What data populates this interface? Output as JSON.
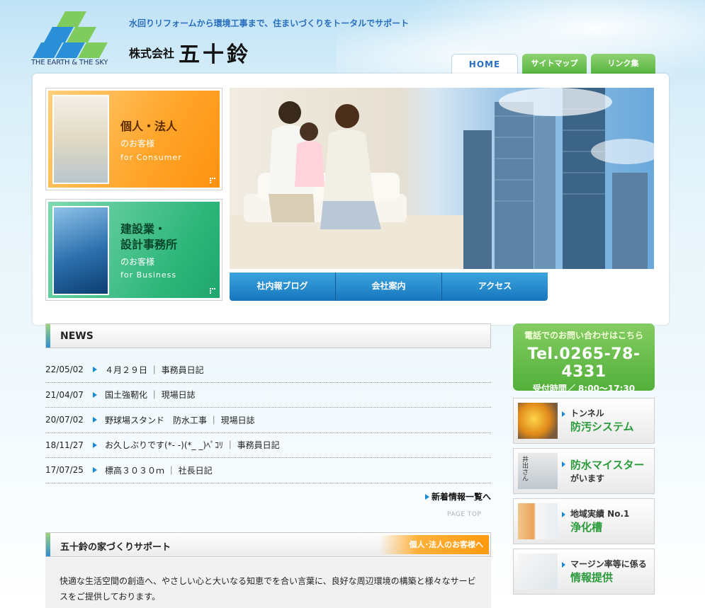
{
  "header": {
    "logo_caption": "THE EARTH & THE SKY",
    "tagline": "水回りリフォームから環境工事まで、住まいづくりをトータルでサポート",
    "brand_small": "株式会社",
    "brand_big": "五十鈴"
  },
  "tabs": [
    {
      "label": "HOME"
    },
    {
      "label": "サイトマップ"
    },
    {
      "label": "リンク集"
    }
  ],
  "customer_boxes": {
    "consumer": {
      "title_line1": "個人・法人",
      "sub": "のお客様",
      "en": "for Consumer"
    },
    "business": {
      "title_line1": "建設業・",
      "title_line2": "設計事務所",
      "sub": "のお客様",
      "en": "for Business"
    }
  },
  "subnav": [
    {
      "label": "社内報ブログ"
    },
    {
      "label": "会社案内"
    },
    {
      "label": "アクセス"
    }
  ],
  "news": {
    "heading": "NEWS",
    "items": [
      {
        "date": "22/05/02",
        "text": "４月２９日 ｜ 事務員日記"
      },
      {
        "date": "21/04/07",
        "text": "国土強靭化 ｜ 現場日誌"
      },
      {
        "date": "20/07/02",
        "text": "野球場スタンド　防水工事 ｜ 現場日誌"
      },
      {
        "date": "18/11/27",
        "text": "お久しぶりです(*- -)(*_ _)ﾍﾟｺﾘ ｜ 事務員日記"
      },
      {
        "date": "17/07/25",
        "text": "標高３０３０ｍ ｜ 社長日記"
      }
    ],
    "more_label": "新着情報一覧へ",
    "pagetop_label": "PAGE TOP"
  },
  "support": {
    "heading": "五十鈴の家づくりサポート",
    "button_label": "個人･法人のお客様へ",
    "body": "快適な生活空間の創造へ、やさしい心と大いなる知恵でを合い言葉に、良好な周辺環境の構築と様々なサービスをご提供しております。"
  },
  "contact": {
    "line1": "電話でのお問い合わせはこちら",
    "tel": "Tel.0265-78-4331",
    "hours": "受付時間／ 8:00～17:30"
  },
  "side_banners": [
    {
      "line1": "トンネル",
      "line2": "防汚システム"
    },
    {
      "line1": "",
      "line2": "防水マイスター",
      "line3": "がいます",
      "photo_caption": "井出さん"
    },
    {
      "line1": "地域実績 No.1",
      "line2": "浄化槽"
    },
    {
      "line1": "マージン率等に係る",
      "line2": "情報提供"
    }
  ],
  "colors": {
    "accent_blue": "#1a8ad4",
    "accent_green": "#52b03a",
    "accent_orange": "#ff9a10"
  }
}
